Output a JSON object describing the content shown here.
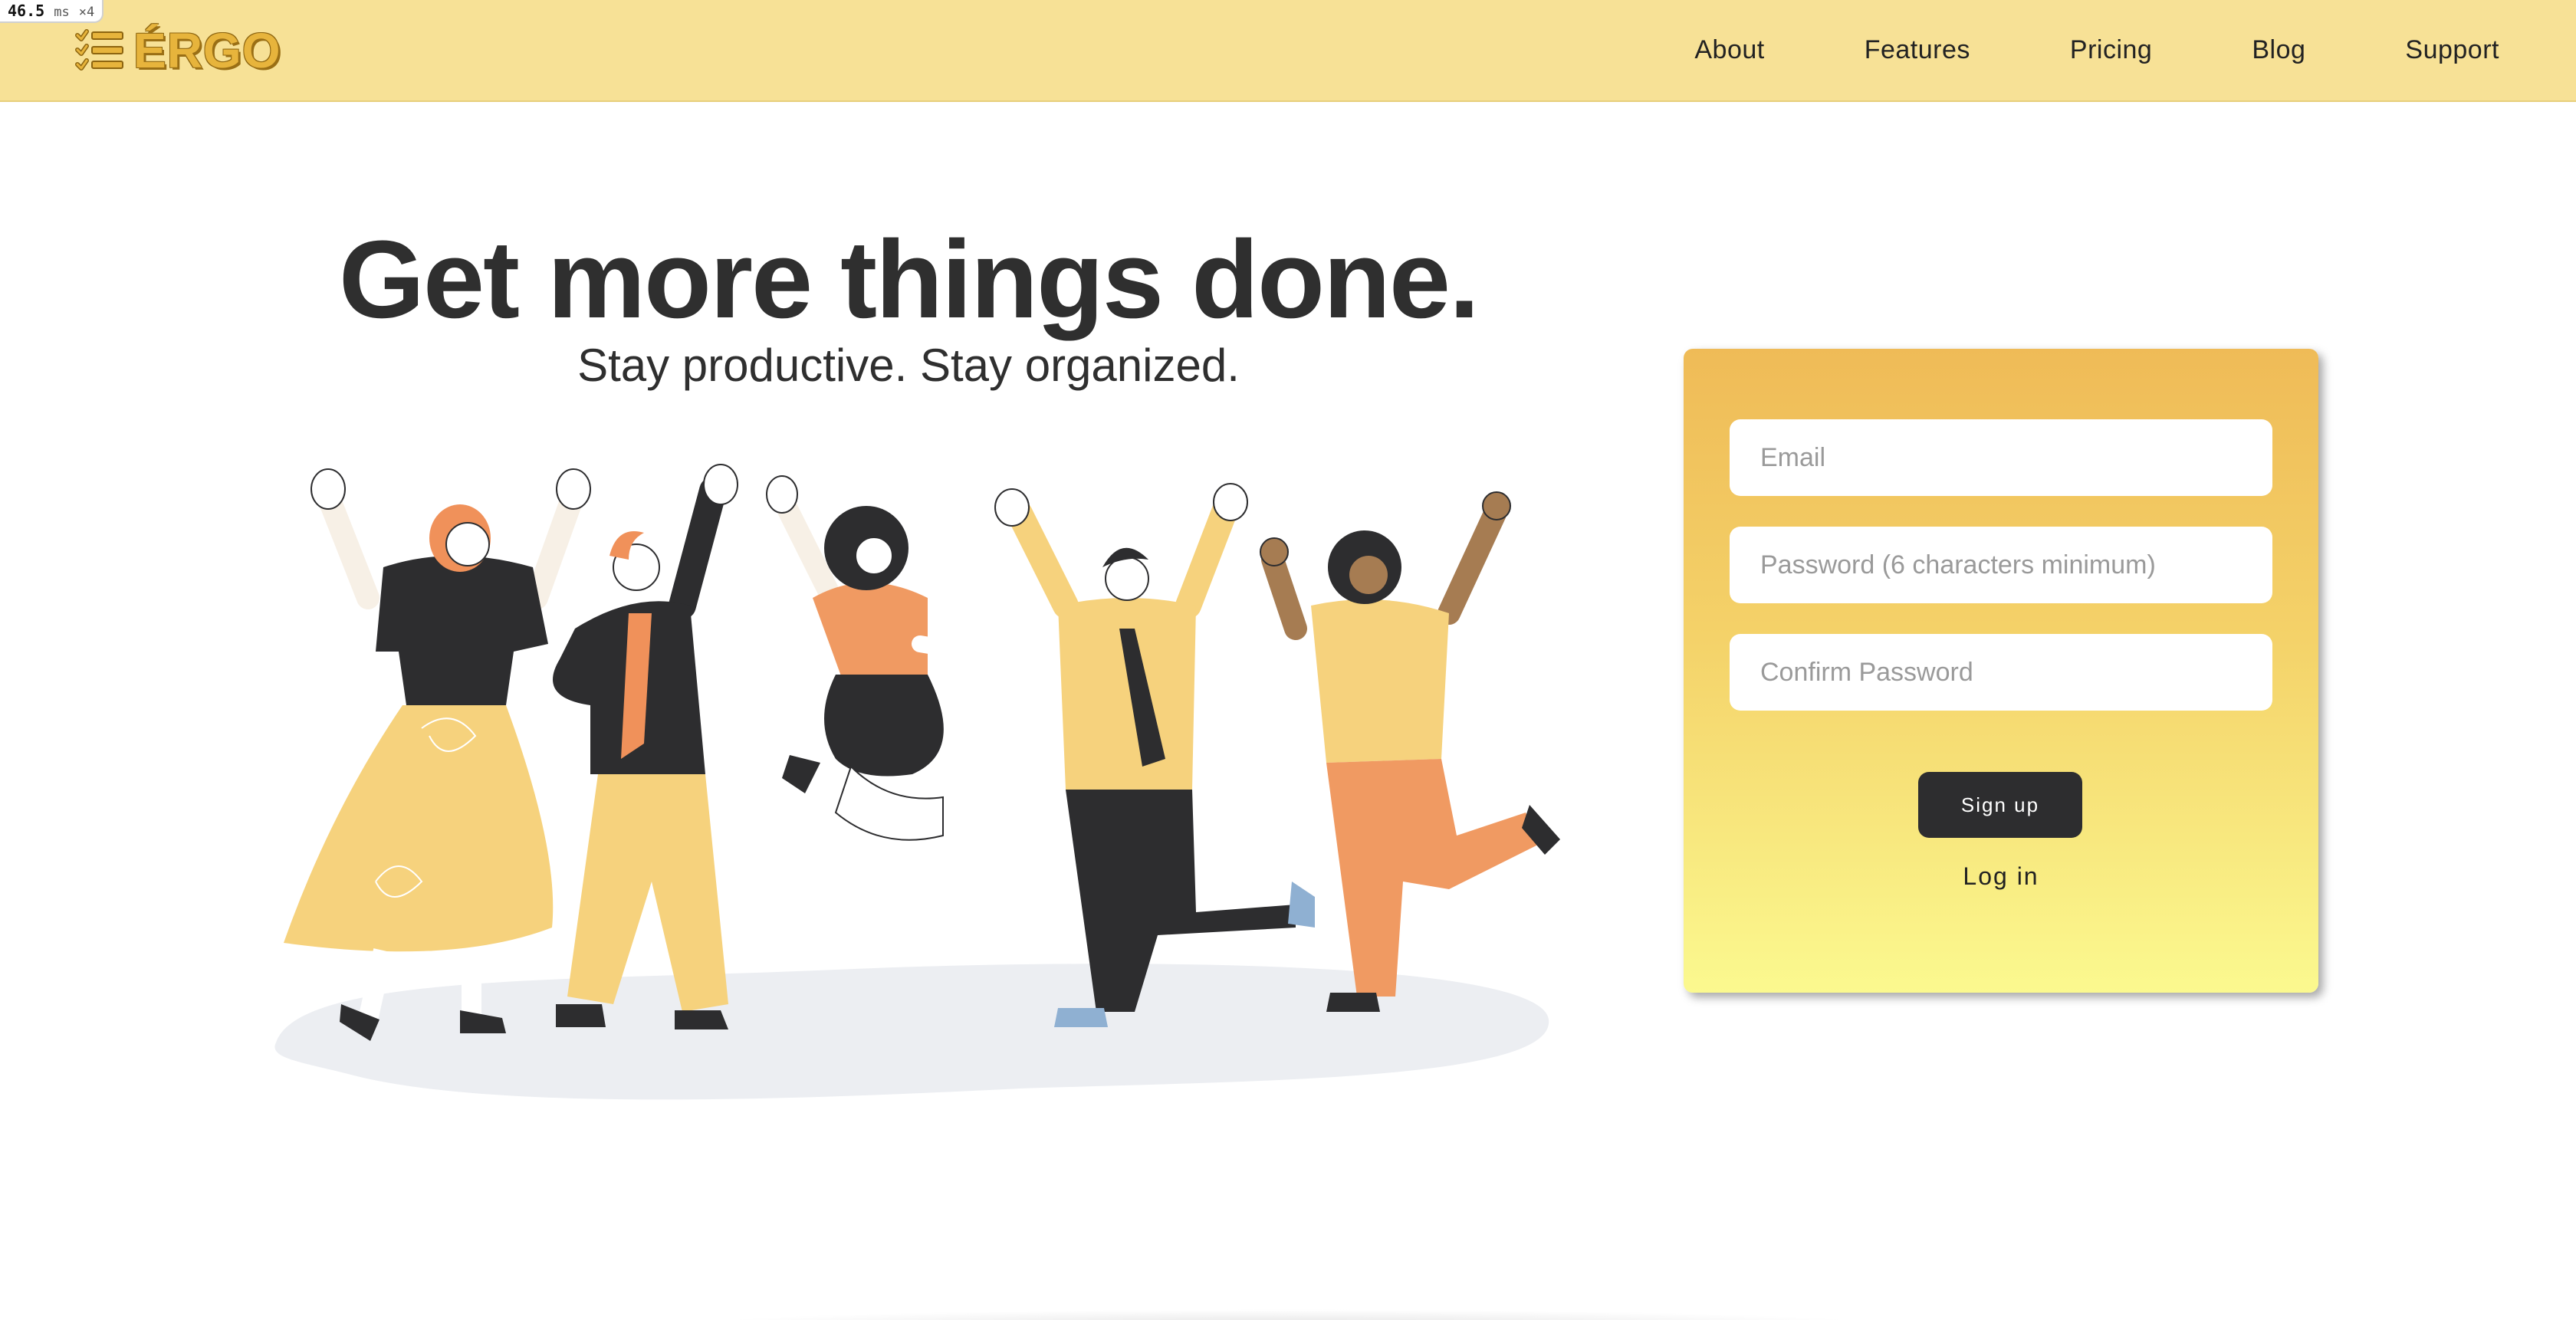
{
  "perf": {
    "value": "46.5",
    "unit": "ms",
    "multiplier": "×4"
  },
  "brand": {
    "name": "ÉRGO",
    "icon": "checklist-icon"
  },
  "nav": {
    "items": [
      {
        "label": "About"
      },
      {
        "label": "Features"
      },
      {
        "label": "Pricing"
      },
      {
        "label": "Blog"
      },
      {
        "label": "Support"
      }
    ]
  },
  "hero": {
    "title": "Get more things done.",
    "subtitle": "Stay productive. Stay organized.",
    "illustration": "people-celebrating-illustration"
  },
  "signup": {
    "email_placeholder": "Email",
    "password_placeholder": "Password (6 characters minimum)",
    "confirm_placeholder": "Confirm Password",
    "signup_label": "Sign up",
    "login_label": "Log in"
  },
  "colors": {
    "navbar": "#f7e196",
    "brand": "#e7b43c",
    "card_top": "#efbb57",
    "card_bottom": "#fbf98f",
    "button": "#2d2d2f",
    "text": "#2f2f2f"
  }
}
